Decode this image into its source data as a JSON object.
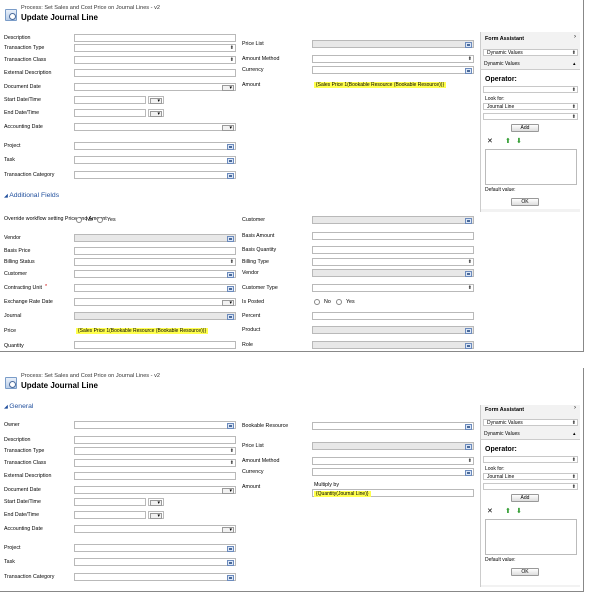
{
  "process": "Process: Set Sales and Cost Price on Journal Lines - v2",
  "title": "Update Journal Line",
  "left_labels": [
    "Description",
    "Transaction Type",
    "Transaction Class",
    "External Description",
    "Document Date",
    "Start Date/Time",
    "End Date/Time",
    "Accounting Date",
    "Project",
    "Task",
    "Transaction Category"
  ],
  "mid_labels": [
    "Price List",
    "Amount Method",
    "Currency",
    "Amount"
  ],
  "amount_value": "{Sales Price 1(Bookable Resource (Bookable Resource))}",
  "additional": "Additional Fields",
  "override_label": "Override workflow setting Price and Amount",
  "no": "No",
  "yes": "Yes",
  "add_left": [
    "Vendor",
    "Basis Price",
    "Billing Status",
    "Customer",
    "Contracting Unit",
    "Exchange Rate Date",
    "Journal",
    "Price",
    "Quantity"
  ],
  "add_right": [
    "Customer",
    "Basis Amount",
    "Basis Quantity",
    "Billing Type",
    "Vendor",
    "Customer Type",
    "Is Posted",
    "Percent",
    "Product",
    "Role"
  ],
  "price_value": "{Sales Price 1(Bookable Resource (Bookable Resource))}",
  "fa": {
    "title": "Form Assistant",
    "dynamic": "Dynamic Values",
    "operator": "Operator:",
    "look_for": "Look for:",
    "journal_line": "Journal Line",
    "add": "Add",
    "default": "Default value:",
    "ok": "OK"
  },
  "p2": {
    "general": "General",
    "owner": "Owner",
    "bookable": "Bookable Resource",
    "multiply_label": "Multiply by",
    "multiply_value": "{Quantity(Journal Line)}"
  }
}
